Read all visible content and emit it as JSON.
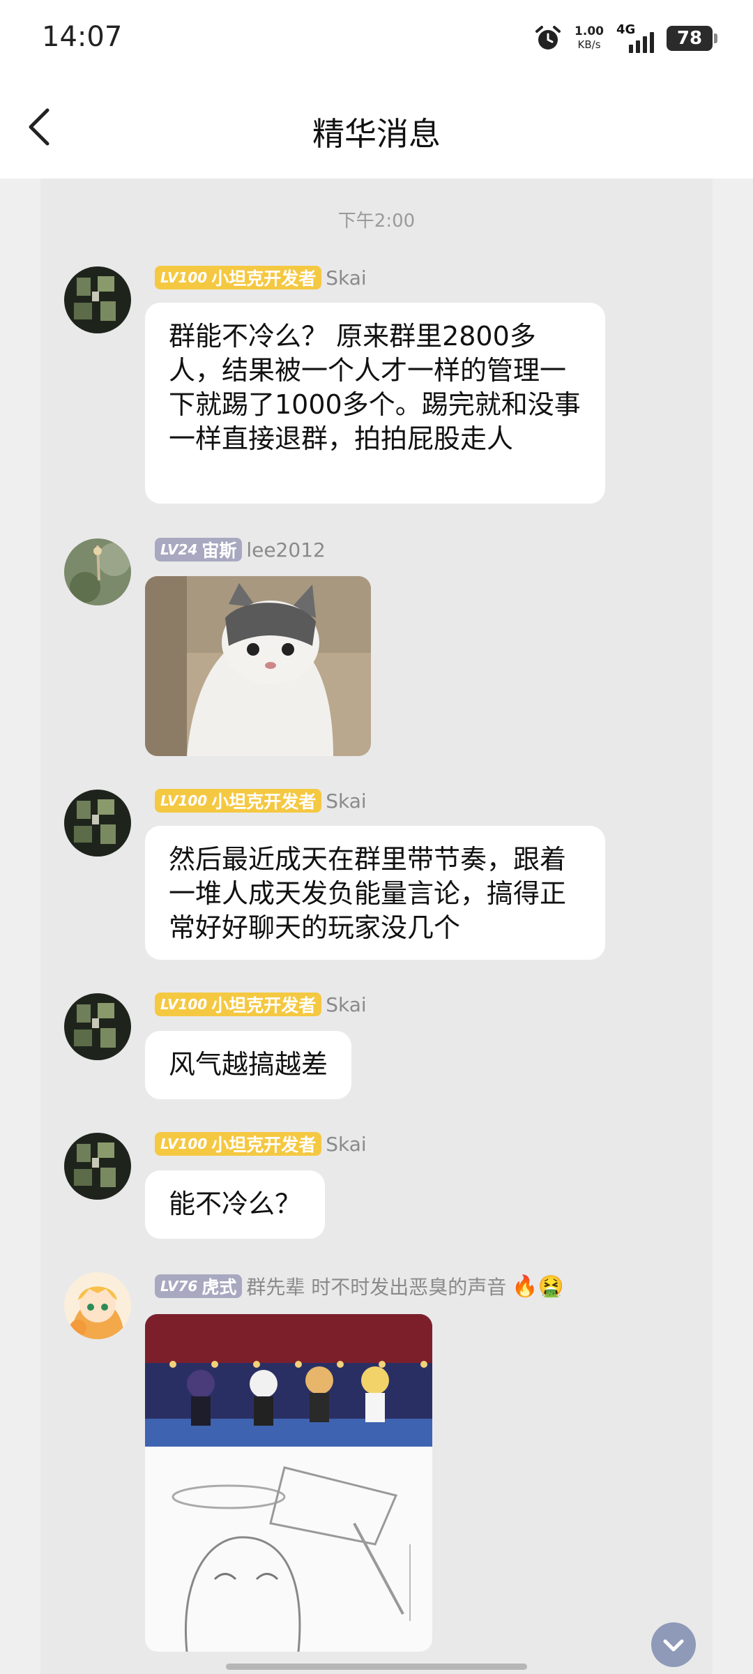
{
  "status_bar": {
    "time": "14:07",
    "net_speed_value": "1.00",
    "net_speed_unit": "KB/s",
    "network_type": "4G",
    "battery": "78"
  },
  "nav": {
    "title": "精华消息"
  },
  "chat": {
    "timestamp": "下午2:00",
    "messages": [
      {
        "level": "LV100",
        "title": "小坦克开发者",
        "name": "Skai",
        "text": "群能不冷么？ 原来群里2800多人，结果被一个人才一样的管理一下就踢了1000多个。踢完就和没事一样直接退群，拍拍屁股走人"
      },
      {
        "level": "LV24",
        "title": "宙斯",
        "name": "lee2012",
        "image": "cat-photo"
      },
      {
        "level": "LV100",
        "title": "小坦克开发者",
        "name": "Skai",
        "text": "然后最近成天在群里带节奏，跟着一堆人成天发负能量言论，搞得正常好好聊天的玩家没几个"
      },
      {
        "level": "LV100",
        "title": "小坦克开发者",
        "name": "Skai",
        "text": "风气越搞越差"
      },
      {
        "level": "LV100",
        "title": "小坦克开发者",
        "name": "Skai",
        "text": "能不冷么？"
      },
      {
        "level": "LV76",
        "title": "虎式",
        "name": "群先辈 时不时发出恶臭的声音",
        "name_emojis": "🔥🤮",
        "image": "anime-comic"
      }
    ]
  },
  "colors": {
    "gold_badge": "#f5c842",
    "gray_badge": "#a8a9c0",
    "chat_background": "#e9e9ea"
  }
}
